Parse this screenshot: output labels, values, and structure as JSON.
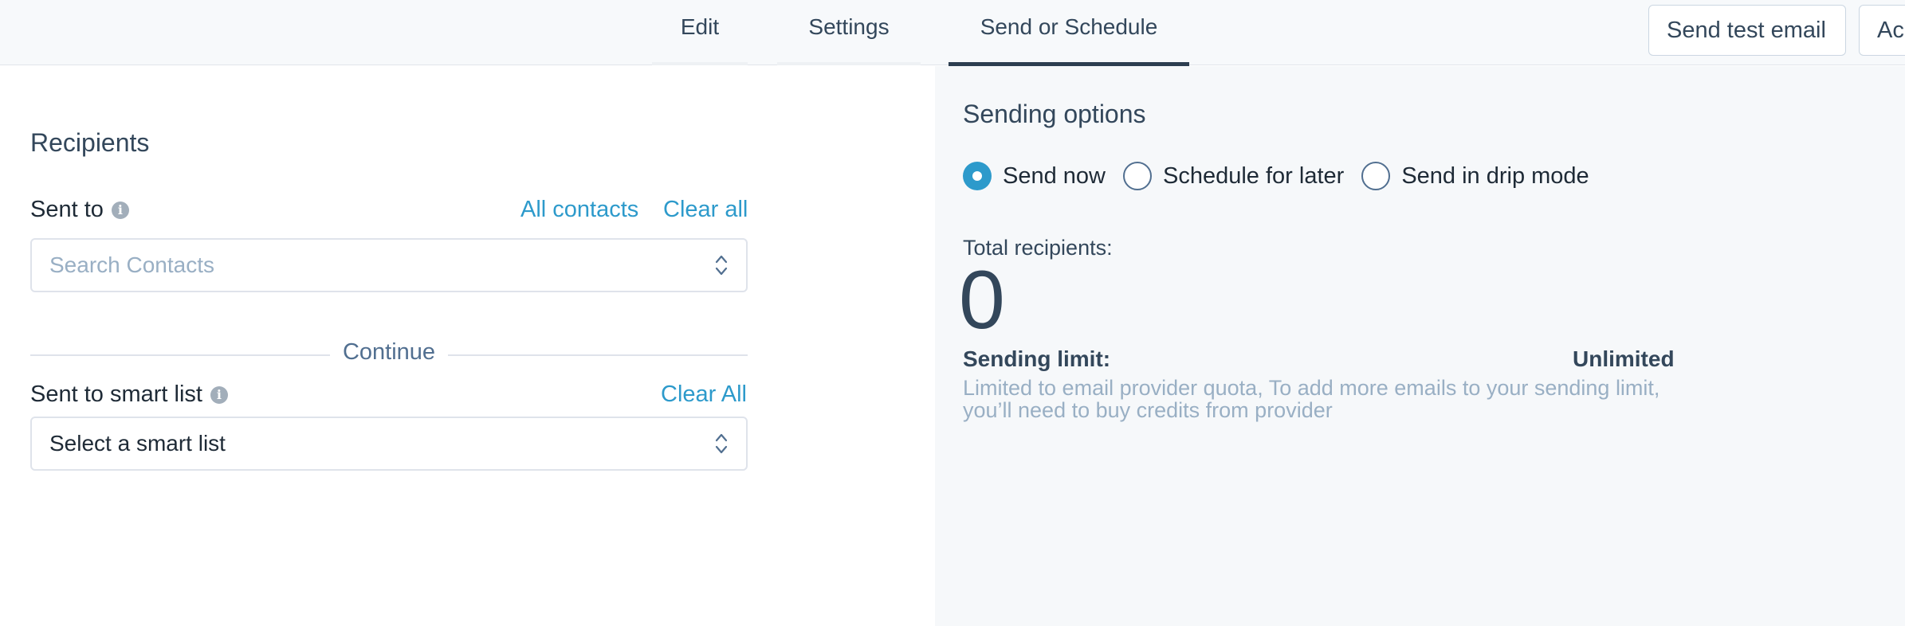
{
  "tabs": [
    {
      "label": "Edit"
    },
    {
      "label": "Settings"
    },
    {
      "label": "Send or Schedule",
      "active": true
    }
  ],
  "header_buttons": {
    "send_test_email": "Send test email",
    "action_truncated": "Ac"
  },
  "recipients": {
    "title": "Recipients",
    "sent_to": {
      "label": "Sent to",
      "all_contacts_link": "All contacts",
      "clear_all_link": "Clear all",
      "placeholder": "Search Contacts"
    },
    "divider_label": "Continue",
    "smart_list": {
      "label": "Sent to smart list",
      "clear_all_link": "Clear All",
      "selected": "Select a smart list"
    }
  },
  "sending_options": {
    "title": "Sending options",
    "radios": [
      {
        "label": "Send now",
        "checked": true
      },
      {
        "label": "Schedule for later",
        "checked": false
      },
      {
        "label": "Send in drip mode",
        "checked": false
      }
    ],
    "total_recipients_label": "Total recipients:",
    "total_recipients_value": "0",
    "sending_limit_label": "Sending limit:",
    "sending_limit_value": "Unlimited",
    "sending_limit_description": "Limited to email provider quota, To add more emails to your sending limit, you’ll need to buy credits from provider"
  },
  "colors": {
    "accent": "#2d9acb",
    "text_dark": "#33475b",
    "muted": "#99afc4",
    "active_tab_underline": "#2d3e50",
    "right_panel_bg": "#f6f8fa"
  },
  "icons": [
    "info-icon",
    "chevron-up-down-icon"
  ]
}
